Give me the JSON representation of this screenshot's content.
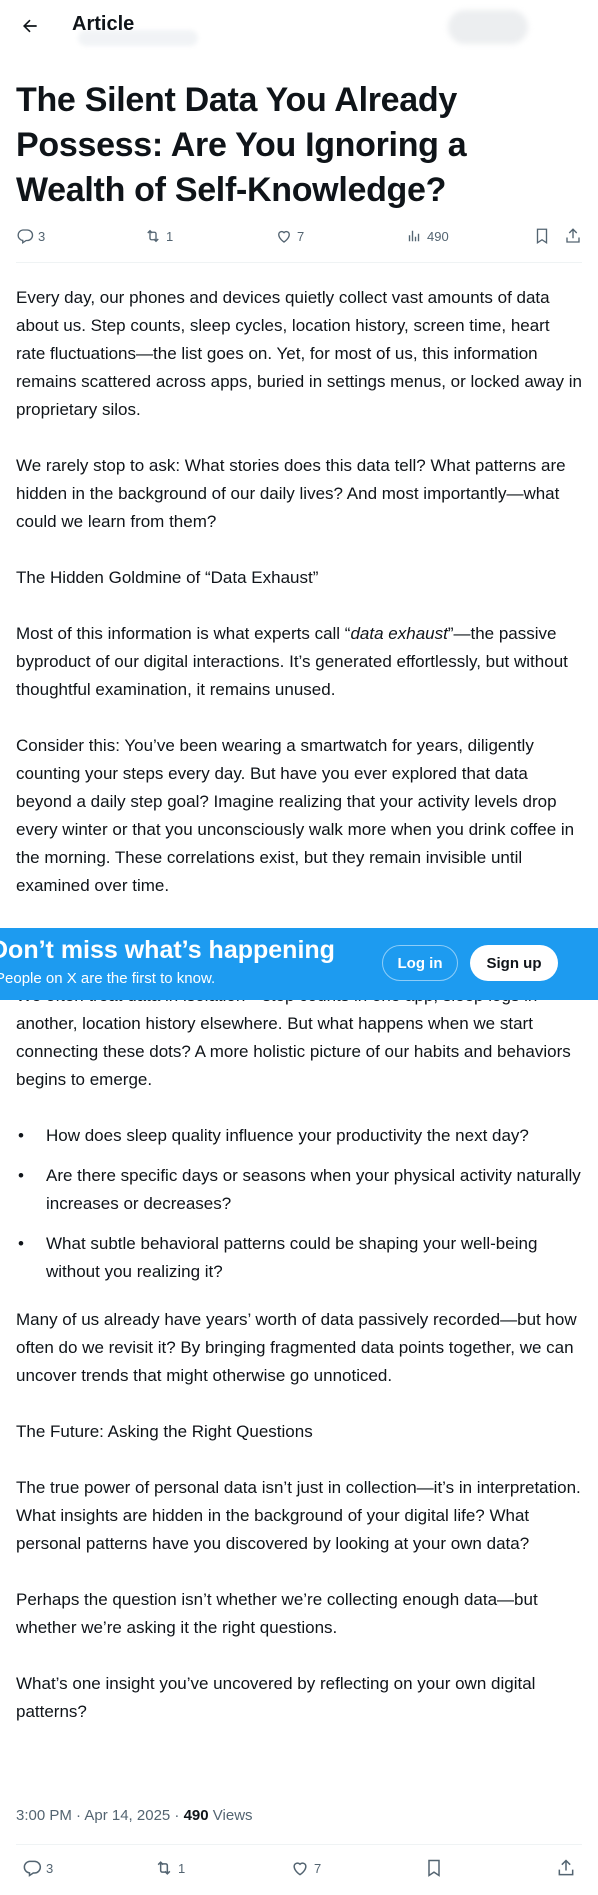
{
  "header": {
    "title": "Article"
  },
  "article": {
    "title": "The Silent Data You Already Possess: Are You Ignoring a Wealth of Self-Knowledge?",
    "stats": {
      "replies": "3",
      "reposts": "1",
      "likes": "7",
      "views": "490"
    },
    "paragraphs_top": [
      "Every day, our phones and devices quietly collect vast amounts of data about us. Step counts, sleep cycles, location history, screen time, heart rate fluctuations—the list goes on. Yet, for most of us, this information remains scattered across apps, buried in settings menus, or locked away in proprietary silos.",
      "We rarely stop to ask: What stories does this data tell? What patterns are hidden in the background of our daily lives? And most importantly—what could we learn from them?",
      "The Hidden Goldmine of “Data Exhaust”",
      "Consider this: You’ve been wearing a smartwatch for years, diligently counting your steps every day. But have you ever explored that data beyond a daily step goal? Imagine realizing that your activity levels drop every winter or that you unconsciously walk more when you drink coffee in the morning. These correlations exist, but they remain invisible until examined over time."
    ],
    "exhaust": {
      "before": "Most of this information is what experts call “",
      "italic": "data exhaust",
      "after": "”—the passive byproduct of our digital interactions. It’s generated effortlessly, but without thoughtful examination, it remains unused."
    },
    "paragraphs_bottom": [
      "We often treat data in isolation—step counts in one app, sleep logs in another, location history elsewhere. But what happens when we start connecting these dots? A more holistic picture of our habits and behaviors begins to emerge.",
      "Many of us already have years’ worth of data passively recorded—but how often do we revisit it? By bringing fragmented data points together, we can uncover trends that might otherwise go unnoticed.",
      "The Future: Asking the Right Questions",
      "The true power of personal data isn’t just in collection—it’s in interpretation. What insights are hidden in the background of your digital life? What personal patterns have you discovered by looking at your own data?",
      "Perhaps the question isn’t whether we’re collecting enough data—but whether we’re asking it the right questions.",
      "What’s one insight you’ve uncovered by reflecting on your own digital patterns?"
    ],
    "bullets": [
      "How does sleep quality influence your productivity the next day?",
      "Are there specific days or seasons when your physical activity naturally increases or decreases?",
      "What subtle behavioral patterns could be shaping your well-being without you realizing it?"
    ],
    "meta": {
      "time": "3:00 PM · Apr 14, 2025 · ",
      "views_count": "490",
      "views_label": " Views"
    }
  },
  "banner": {
    "headline": "Don’t miss what’s happening",
    "sub": "People on X are the first to know.",
    "login": "Log in",
    "signup": "Sign up"
  },
  "colors": {
    "accent": "#1d9bf0",
    "text": "#0f1419",
    "muted": "#536471"
  }
}
